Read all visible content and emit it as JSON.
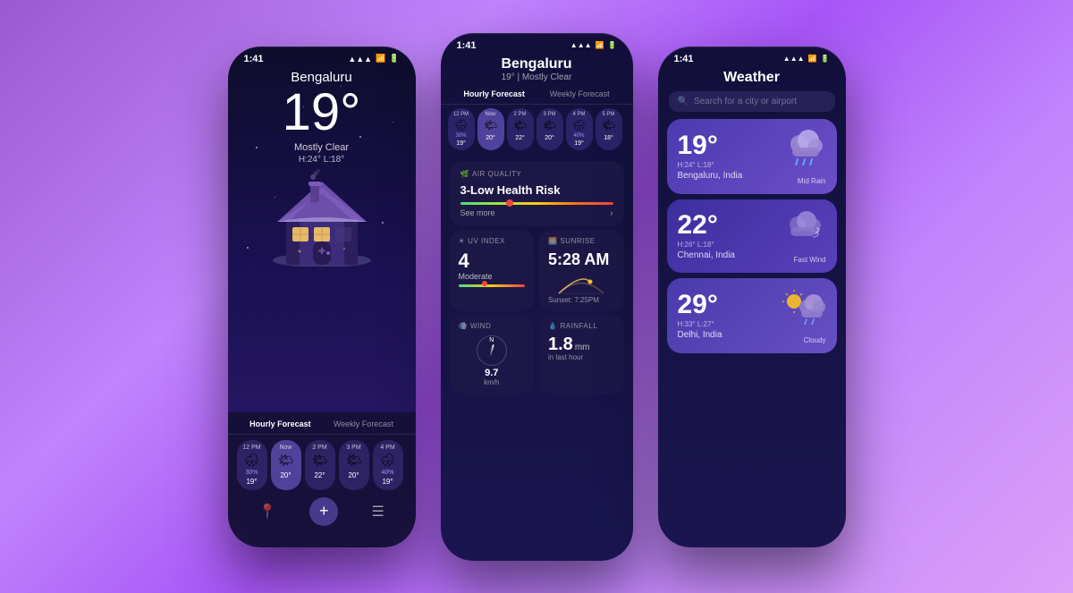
{
  "background": "#a855f7",
  "phone1": {
    "status_time": "1:41",
    "city": "Bengaluru",
    "temperature": "19°",
    "description": "Mostly Clear",
    "high": "H:24°",
    "low": "L:18°",
    "forecast_tabs": [
      "Hourly Forecast",
      "Weekly Forecast"
    ],
    "hourly": [
      {
        "time": "12 PM",
        "icon": "🌧",
        "precip": "30%",
        "temp": "19°"
      },
      {
        "time": "Now",
        "icon": "🌤",
        "precip": "",
        "temp": "20°",
        "active": true
      },
      {
        "time": "2 PM",
        "icon": "🌤",
        "precip": "",
        "temp": "22°"
      },
      {
        "time": "3 PM",
        "icon": "🌤",
        "precip": "",
        "temp": "20°"
      },
      {
        "time": "4 PM",
        "icon": "🌧",
        "precip": "40%",
        "temp": "19°"
      }
    ],
    "nav_icons": [
      "📍",
      "+",
      "☰"
    ]
  },
  "phone2": {
    "status_time": "1:41",
    "city": "Bengaluru",
    "subtitle": "19° | Mostly Clear",
    "forecast_tabs": [
      "Hourly Forecast",
      "Weekly Forecast"
    ],
    "hourly": [
      {
        "time": "12 PM",
        "icon": "🌧",
        "precip": "30%",
        "temp": "19°"
      },
      {
        "time": "Now",
        "icon": "🌤",
        "precip": "",
        "temp": "20°",
        "active": true
      },
      {
        "time": "2 PM",
        "icon": "🌤",
        "precip": "",
        "temp": "22°"
      },
      {
        "time": "3 PM",
        "icon": "🌤",
        "precip": "",
        "temp": "20°"
      },
      {
        "time": "4 PM",
        "icon": "🌧",
        "precip": "40%",
        "temp": "19°"
      },
      {
        "time": "5 PM",
        "icon": "🌤",
        "precip": "",
        "temp": "18°"
      }
    ],
    "air_quality": {
      "label": "AIR QUALITY",
      "value": "3-Low Health Risk",
      "see_more": "See more"
    },
    "uv_index": {
      "label": "UV INDEX",
      "value": "4",
      "description": "Moderate"
    },
    "sunrise": {
      "label": "SUNRISE",
      "time": "5:28 AM",
      "sunset_label": "Sunset: 7:25PM"
    },
    "wind": {
      "label": "WIND",
      "direction": "N",
      "speed": "9.7",
      "unit": "km/h"
    },
    "rainfall": {
      "label": "RAINFALL",
      "value": "1.8 mm",
      "sublabel": "in last hour"
    }
  },
  "phone3": {
    "status_time": "1:41",
    "title": "Weather",
    "search_placeholder": "Search for a city or airport",
    "cities": [
      {
        "temp": "19°",
        "high": "H:24°",
        "low": "L:18°",
        "city": "Bengaluru, India",
        "icon": "🌧",
        "description": "Mid Rain"
      },
      {
        "temp": "22°",
        "high": "H:26°",
        "low": "L:18°",
        "city": "Chennai, India",
        "icon": "💨",
        "description": "Fast Wind"
      },
      {
        "temp": "29°",
        "high": "H:33°",
        "low": "L:27°",
        "city": "Delhi, India",
        "icon": "⛅",
        "description": "Cloudy"
      }
    ]
  }
}
